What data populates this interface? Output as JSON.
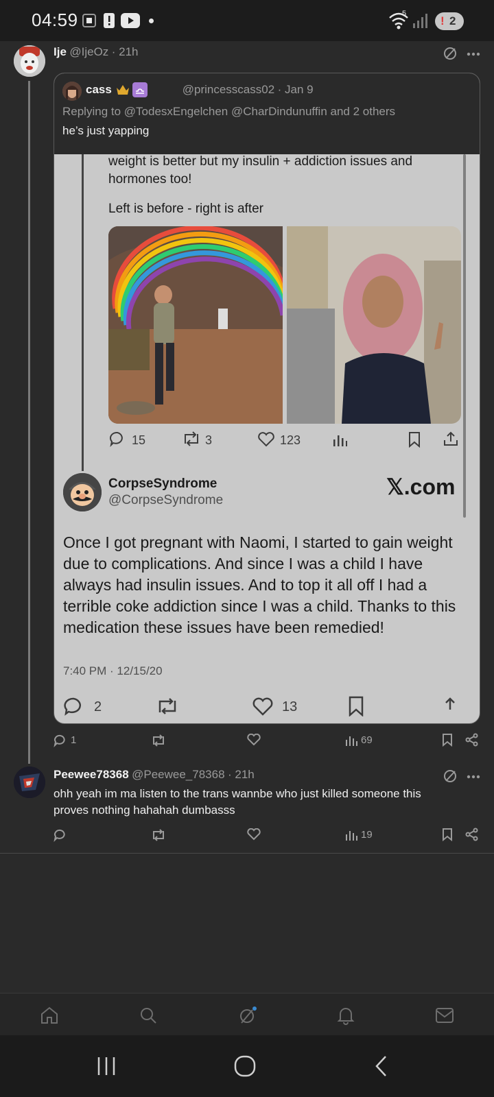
{
  "status_bar": {
    "time": "04:59",
    "notification_count": "2",
    "wifi_label": "5"
  },
  "post1": {
    "author_name": "Ije",
    "author_handle": "@IjeOz",
    "time": "· 21h",
    "quote": {
      "author_name": "cass",
      "author_handle": "@princesscass02",
      "date": "· Jan 9",
      "replying_prefix": "Replying to ",
      "replying_to": "@TodesxEngelchen @CharDindunuffin",
      "replying_suffix": " and 2 others",
      "text": "he’s just yapping",
      "screenshot": {
        "upper_text_line1": "weight is better but my insulin + addiction issues and",
        "upper_text_line2": "hormones too!",
        "caption": "Left is before - right is after",
        "actions": {
          "replies": "15",
          "retweets": "3",
          "likes": "123"
        },
        "tweet": {
          "author_name": "CorpseSyndrome",
          "author_handle": "@CorpseSyndrome",
          "brand": "𝕏.com",
          "body": [
            "Once I got pregnant with Naomi, I started to gain weight",
            "due to complications. And since I was a child I have",
            "always had insulin issues. And to top it all off I had a",
            "terrible coke addiction since I was a child. Thanks to this",
            "medication these issues have been remedied!"
          ],
          "timestamp": "7:40 PM · 12/15/20",
          "replies": "2",
          "likes": "13"
        }
      }
    },
    "actions": {
      "replies": "1",
      "views": "69"
    }
  },
  "post2": {
    "author_name": "Peewee78368",
    "author_handle": "@Peewee_78368",
    "time": "· 21h",
    "text_line1": "ohh yeah im ma listen to the trans wannbe who just killed someone this",
    "text_line2": "proves nothing hahahah dumbasss",
    "actions": {
      "views": "19"
    }
  },
  "colors": {
    "background": "#2a2a2a",
    "quote_screenshot_bg": "#c9c9c9",
    "badge_red": "#e03a3a"
  }
}
